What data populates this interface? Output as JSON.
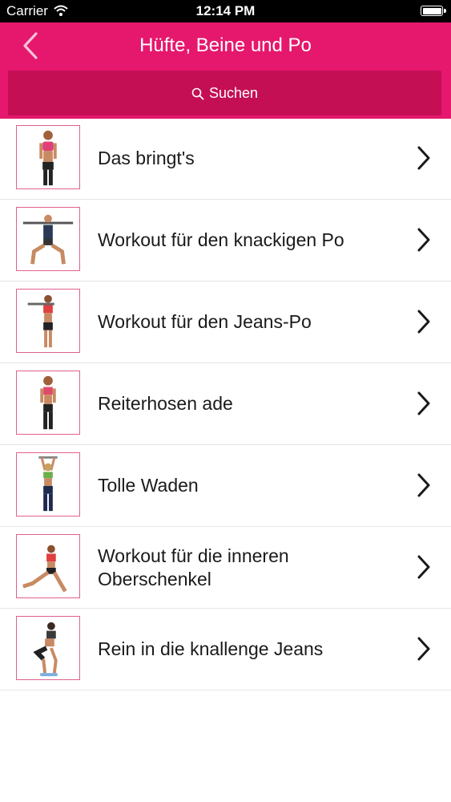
{
  "status_bar": {
    "carrier": "Carrier",
    "time": "12:14 PM",
    "wifi_icon": "wifi-icon",
    "battery_icon": "battery-icon"
  },
  "nav": {
    "title": "Hüfte, Beine und Po",
    "back_icon": "chevron-left-icon"
  },
  "search": {
    "placeholder": "Suchen",
    "icon": "search-icon"
  },
  "items": [
    {
      "label": "Das bringt's",
      "thumb": "standing-pose"
    },
    {
      "label": "Workout für den knackigen Po",
      "thumb": "squat-with-bar"
    },
    {
      "label": "Workout für den Jeans-Po",
      "thumb": "standing-with-bar"
    },
    {
      "label": "Reiterhosen ade",
      "thumb": "standing-pose"
    },
    {
      "label": "Tolle Waden",
      "thumb": "arms-overhead"
    },
    {
      "label": "Workout für die inneren Oberschenkel",
      "thumb": "side-lunge"
    },
    {
      "label": "Rein in die knallenge Jeans",
      "thumb": "squat"
    }
  ],
  "colors": {
    "accent": "#e5186d",
    "search_bg": "#c40f55",
    "thumb_border": "#e0608f"
  }
}
